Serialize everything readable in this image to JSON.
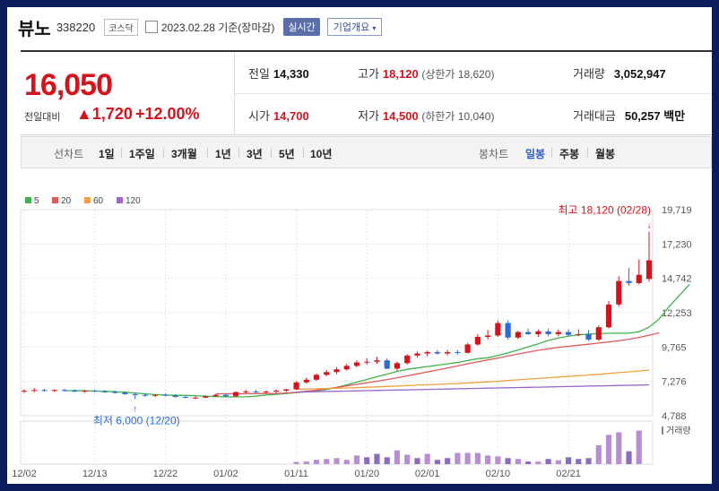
{
  "header": {
    "name": "뷰노",
    "code": "338220",
    "market": "코스닥",
    "date_text": "2023.02.28 기준(장마감)",
    "live_label": "실시간",
    "overview_label": "기업개요"
  },
  "quote": {
    "price": "16,050",
    "change_label": "전일대비",
    "change_value": "1,720",
    "change_pct": "+12.00%",
    "prev_label": "전일",
    "prev_value": "14,330",
    "high_label": "고가",
    "high_value": "18,120",
    "upper_limit_label": "상한가",
    "upper_limit_value": "18,620",
    "volume_label": "거래량",
    "volume_value": "3,052,947",
    "open_label": "시가",
    "open_value": "14,700",
    "low_label": "저가",
    "low_value": "14,500",
    "lower_limit_label": "하한가",
    "lower_limit_value": "10,040",
    "amount_label": "거래대금",
    "amount_value": "50,257 백만"
  },
  "periods": {
    "line_label": "선차트",
    "line_items": [
      "1일",
      "1주일",
      "3개월",
      "1년",
      "3년",
      "5년",
      "10년"
    ],
    "candle_label": "봉차트",
    "candle_items": [
      "일봉",
      "주봉",
      "월봉"
    ],
    "active_candle": "일봉"
  },
  "chart_data": {
    "type": "candlestick",
    "legend": [
      {
        "name": "5",
        "color": "#3cb34a"
      },
      {
        "name": "20",
        "color": "#e05a5a"
      },
      {
        "name": "60",
        "color": "#f0a040"
      },
      {
        "name": "120",
        "color": "#9966cc"
      }
    ],
    "y_ticks": [
      "19,719",
      "17,230",
      "14,742",
      "12,253",
      "9,765",
      "7,276",
      "4,788"
    ],
    "ylim": [
      4788,
      19719
    ],
    "x_ticks": [
      {
        "label": "12/02",
        "index": 0
      },
      {
        "label": "12/13",
        "index": 7
      },
      {
        "label": "12/22",
        "index": 14
      },
      {
        "label": "01/02",
        "index": 20
      },
      {
        "label": "01/11",
        "index": 27
      },
      {
        "label": "01/20",
        "index": 34
      },
      {
        "label": "02/01",
        "index": 40
      },
      {
        "label": "02/10",
        "index": 47
      },
      {
        "label": "02/21",
        "index": 54
      }
    ],
    "candles": [
      [
        6550,
        6700,
        6450,
        6600
      ],
      [
        6600,
        6800,
        6500,
        6650
      ],
      [
        6650,
        6750,
        6550,
        6600
      ],
      [
        6600,
        6700,
        6500,
        6650
      ],
      [
        6650,
        6750,
        6550,
        6600
      ],
      [
        6600,
        6700,
        6500,
        6550
      ],
      [
        6550,
        6650,
        6450,
        6600
      ],
      [
        6600,
        6700,
        6500,
        6550
      ],
      [
        6550,
        6650,
        6450,
        6500
      ],
      [
        6500,
        6600,
        6400,
        6450
      ],
      [
        6450,
        6550,
        6300,
        6350
      ],
      [
        6350,
        6450,
        6000,
        6300
      ],
      [
        6300,
        6400,
        6150,
        6250
      ],
      [
        6250,
        6350,
        6150,
        6300
      ],
      [
        6300,
        6400,
        6200,
        6250
      ],
      [
        6250,
        6350,
        6100,
        6150
      ],
      [
        6150,
        6250,
        6050,
        6100
      ],
      [
        6100,
        6200,
        6000,
        6100
      ],
      [
        6100,
        6250,
        6050,
        6200
      ],
      [
        6200,
        6350,
        6150,
        6300
      ],
      [
        6300,
        6400,
        6150,
        6200
      ],
      [
        6200,
        6550,
        6150,
        6500
      ],
      [
        6500,
        6650,
        6400,
        6550
      ],
      [
        6550,
        6650,
        6450,
        6500
      ],
      [
        6500,
        6600,
        6400,
        6550
      ],
      [
        6550,
        6700,
        6450,
        6600
      ],
      [
        6600,
        6750,
        6500,
        6700
      ],
      [
        6700,
        7300,
        6650,
        7200
      ],
      [
        7200,
        7550,
        7100,
        7400
      ],
      [
        7400,
        7850,
        7300,
        7750
      ],
      [
        7750,
        8100,
        7650,
        7950
      ],
      [
        7950,
        8300,
        7800,
        8150
      ],
      [
        8150,
        8550,
        8050,
        8400
      ],
      [
        8400,
        8800,
        8300,
        8650
      ],
      [
        8650,
        8950,
        8500,
        8700
      ],
      [
        8700,
        9050,
        8550,
        8800
      ],
      [
        8800,
        8950,
        8150,
        8200
      ],
      [
        8200,
        8700,
        8050,
        8600
      ],
      [
        8600,
        9250,
        8500,
        9150
      ],
      [
        9150,
        9450,
        9000,
        9300
      ],
      [
        9300,
        9500,
        9100,
        9400
      ],
      [
        9400,
        9550,
        9200,
        9300
      ],
      [
        9300,
        9550,
        9150,
        9400
      ],
      [
        9400,
        9550,
        9200,
        9350
      ],
      [
        9350,
        10050,
        9300,
        9950
      ],
      [
        9950,
        10700,
        9850,
        10500
      ],
      [
        10500,
        11000,
        10300,
        10600
      ],
      [
        10600,
        11700,
        10500,
        11500
      ],
      [
        11500,
        11700,
        10300,
        10450
      ],
      [
        10450,
        10950,
        10350,
        10850
      ],
      [
        10850,
        11100,
        10650,
        10700
      ],
      [
        10700,
        11050,
        10500,
        10900
      ],
      [
        10900,
        11100,
        10550,
        10700
      ],
      [
        10700,
        11050,
        10550,
        10850
      ],
      [
        10850,
        11050,
        10550,
        10650
      ],
      [
        10650,
        11050,
        10550,
        10700
      ],
      [
        10700,
        11000,
        10200,
        10300
      ],
      [
        10300,
        11350,
        10200,
        11200
      ],
      [
        11200,
        13100,
        11100,
        12850
      ],
      [
        12850,
        14900,
        12700,
        14550
      ],
      [
        14550,
        15500,
        14200,
        14400
      ],
      [
        14400,
        16100,
        14300,
        15000
      ],
      [
        14700,
        18120,
        14500,
        16050
      ]
    ],
    "ma": {
      "5": {
        "start": 4,
        "values": [
          6600,
          6610,
          6590,
          6570,
          6560,
          6530,
          6490,
          6440,
          6380,
          6320,
          6290,
          6270,
          6260,
          6240,
          6210,
          6180,
          6160,
          6150,
          6160,
          6200,
          6280,
          6340,
          6400,
          6460,
          6520,
          6590,
          6690,
          6850,
          7030,
          7220,
          7410,
          7620,
          7800,
          8000,
          8150,
          8250,
          8350,
          8450,
          8550,
          8650,
          8790,
          8920,
          8990,
          9150,
          9350,
          9550,
          9780,
          10000,
          10250,
          10420,
          10560,
          10650,
          10700,
          10740,
          10760,
          10770,
          10770,
          10880,
          11200,
          11800,
          12700,
          13500,
          14300
        ]
      },
      "20": {
        "start": 19,
        "values": [
          6380,
          6380,
          6380,
          6380,
          6390,
          6390,
          6400,
          6440,
          6490,
          6560,
          6640,
          6740,
          6840,
          6950,
          7060,
          7180,
          7290,
          7410,
          7540,
          7680,
          7820,
          7960,
          8100,
          8250,
          8400,
          8550,
          8690,
          8830,
          8970,
          9110,
          9260,
          9400,
          9530,
          9640,
          9740,
          9820,
          9900,
          9970,
          10050,
          10130,
          10220,
          10330,
          10460,
          10610,
          10800
        ]
      },
      "60": {
        "start": 27,
        "values": [
          6700,
          6720,
          6740,
          6760,
          6780,
          6800,
          6820,
          6850,
          6880,
          6910,
          6940,
          6970,
          7000,
          7030,
          7060,
          7090,
          7120,
          7160,
          7200,
          7240,
          7290,
          7340,
          7390,
          7440,
          7490,
          7540,
          7590,
          7640,
          7690,
          7740,
          7790,
          7850,
          7910,
          7970,
          8030,
          8090
        ]
      },
      "120": {
        "start": 27,
        "values": [
          6500,
          6515,
          6530,
          6545,
          6560,
          6575,
          6590,
          6605,
          6620,
          6635,
          6650,
          6665,
          6680,
          6695,
          6710,
          6725,
          6740,
          6755,
          6770,
          6785,
          6800,
          6815,
          6830,
          6845,
          6860,
          6875,
          6890,
          6905,
          6920,
          6935,
          6950,
          6965,
          6980,
          6995,
          7010,
          7030
        ]
      }
    },
    "volume": [
      0,
      0,
      0,
      0,
      0,
      0,
      0,
      0,
      0,
      0,
      0,
      0,
      0,
      0,
      0,
      0,
      0,
      0,
      0,
      0,
      0,
      0,
      0,
      0,
      0,
      0,
      0,
      0.05,
      0.06,
      0.1,
      0.12,
      0.14,
      0.1,
      0.2,
      0.16,
      0.24,
      0.16,
      0.32,
      0.22,
      0.14,
      0.24,
      0.1,
      0.14,
      0.26,
      0.26,
      0.26,
      0.2,
      0.18,
      0.14,
      0.12,
      0.06,
      0.06,
      0.12,
      0.09,
      0.16,
      0.12,
      0.14,
      0.44,
      0.68,
      0.74,
      0.3,
      0.78
    ],
    "volume_colors_red": [
      27,
      28,
      29,
      30,
      31,
      32,
      33,
      37,
      38,
      40,
      43,
      44,
      45,
      46,
      47,
      49,
      51,
      53,
      57,
      58,
      59,
      61,
      62
    ],
    "volume_label": "거래량",
    "high_annotation": "최고 18,120 (02/28)",
    "low_annotation": "최저 6,000 (12/20)",
    "low_index": 11
  },
  "colors": {
    "up": "#d6131c",
    "down": "#2a6bd6",
    "volume_up": "#b88dd6",
    "volume_down": "#8a6bbf"
  }
}
